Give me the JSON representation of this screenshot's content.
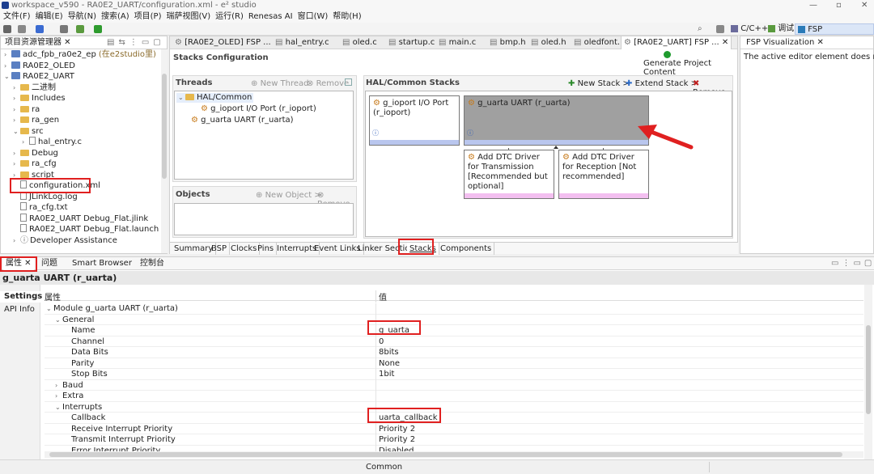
{
  "window": {
    "title": "workspace_v590 - RA0E2_UART/configuration.xml - e² studio"
  },
  "menu": [
    "文件(F)",
    "编辑(E)",
    "导航(N)",
    "搜索(A)",
    "项目(P)",
    "瑞萨视图(V)",
    "运行(R)",
    "Renesas AI",
    "窗口(W)",
    "帮助(H)"
  ],
  "perspectives": [
    "C/C++",
    "调试",
    "FSP Configuration"
  ],
  "explorer": {
    "title": "项目资源管理器",
    "items": [
      {
        "label": "adc_fpb_ra0e2_ep",
        "suffix": "(在e2studio里)",
        "type": "project",
        "arrow": "›",
        "indent": 0
      },
      {
        "label": "RA0E2_OLED",
        "type": "project",
        "arrow": "›",
        "indent": 0
      },
      {
        "label": "RA0E2_UART",
        "type": "project",
        "arrow": "⌄",
        "indent": 0
      },
      {
        "label": "二进制",
        "type": "folder",
        "arrow": "›",
        "indent": 1
      },
      {
        "label": "Includes",
        "type": "folder",
        "arrow": "›",
        "indent": 1
      },
      {
        "label": "ra",
        "type": "folder",
        "arrow": "›",
        "indent": 1
      },
      {
        "label": "ra_gen",
        "type": "folder",
        "arrow": "›",
        "indent": 1
      },
      {
        "label": "src",
        "type": "folder",
        "arrow": "⌄",
        "indent": 1
      },
      {
        "label": "hal_entry.c",
        "type": "file",
        "arrow": "›",
        "indent": 2
      },
      {
        "label": "Debug",
        "type": "folder",
        "arrow": "›",
        "indent": 1
      },
      {
        "label": "ra_cfg",
        "type": "folder",
        "arrow": "›",
        "indent": 1
      },
      {
        "label": "script",
        "type": "folder",
        "arrow": "›",
        "indent": 1
      },
      {
        "label": "configuration.xml",
        "type": "file",
        "arrow": "",
        "indent": 1
      },
      {
        "label": "JLinkLog.log",
        "type": "file",
        "arrow": "",
        "indent": 1
      },
      {
        "label": "ra_cfg.txt",
        "type": "file",
        "arrow": "",
        "indent": 1
      },
      {
        "label": "RA0E2_UART Debug_Flat.jlink",
        "type": "file",
        "arrow": "",
        "indent": 1
      },
      {
        "label": "RA0E2_UART Debug_Flat.launch",
        "type": "file",
        "arrow": "",
        "indent": 1
      },
      {
        "label": "Developer Assistance",
        "type": "help",
        "arrow": "›",
        "indent": 1
      }
    ]
  },
  "editor_tabs": [
    "[RA0E2_OLED] FSP ...",
    "hal_entry.c",
    "oled.c",
    "startup.c",
    "main.c",
    "bmp.h",
    "oled.h",
    "oledfont.h",
    "[RA0E2_UART] FSP ..."
  ],
  "fsp_vis": {
    "tab": "FSP Visualization",
    "message": "The active editor element does not us"
  },
  "stacks": {
    "header": "Stacks Configuration",
    "generate": "Generate Project Content",
    "threads": {
      "title": "Threads",
      "new_thread": "New Thread",
      "remove": "Remove",
      "root": "HAL/Common",
      "items": [
        "g_ioport I/O Port (r_ioport)",
        "g_uarta UART (r_uarta)"
      ]
    },
    "objects": {
      "title": "Objects",
      "new_object": "New Object >",
      "remove": "Remove"
    },
    "hal": {
      "title": "HAL/Common Stacks",
      "new_stack": "New Stack >",
      "extend_stack": "Extend Stack >",
      "remove": "Remove",
      "block1": "g_ioport I/O Port (r_ioport)",
      "block2": "g_uarta UART (r_uarta)",
      "block3": "Add DTC Driver for Transmission [Recommended but optional]",
      "block4": "Add DTC Driver for Reception [Not recommended]"
    },
    "bottom_tabs": [
      "Summary",
      "BSP",
      "Clocks",
      "Pins",
      "Interrupts",
      "Event Links",
      "Linker Section",
      "Stacks",
      "Components"
    ]
  },
  "props": {
    "tabs": [
      "属性",
      "问题",
      "Smart Browser",
      "控制台"
    ],
    "title": "g_uarta UART (r_uarta)",
    "side": [
      "Settings",
      "API Info"
    ],
    "col_prop": "属性",
    "col_val": "值",
    "rows": [
      {
        "k": "Module g_uarta UART (r_uarta)",
        "v": "",
        "lvl": 0,
        "arrow": "⌄"
      },
      {
        "k": "General",
        "v": "",
        "lvl": 1,
        "arrow": "⌄"
      },
      {
        "k": "Name",
        "v": "g_uarta",
        "lvl": 2,
        "arrow": ""
      },
      {
        "k": "Channel",
        "v": "0",
        "lvl": 2,
        "arrow": ""
      },
      {
        "k": "Data Bits",
        "v": "8bits",
        "lvl": 2,
        "arrow": ""
      },
      {
        "k": "Parity",
        "v": "None",
        "lvl": 2,
        "arrow": ""
      },
      {
        "k": "Stop Bits",
        "v": "1bit",
        "lvl": 2,
        "arrow": ""
      },
      {
        "k": "Baud",
        "v": "",
        "lvl": 1,
        "arrow": "›"
      },
      {
        "k": "Extra",
        "v": "",
        "lvl": 1,
        "arrow": "›"
      },
      {
        "k": "Interrupts",
        "v": "",
        "lvl": 1,
        "arrow": "⌄"
      },
      {
        "k": "Callback",
        "v": "uarta_callback",
        "lvl": 2,
        "arrow": ""
      },
      {
        "k": "Receive Interrupt Priority",
        "v": "Priority 2",
        "lvl": 2,
        "arrow": ""
      },
      {
        "k": "Transmit Interrupt Priority",
        "v": "Priority 2",
        "lvl": 2,
        "arrow": ""
      },
      {
        "k": "Error Interrupt Priority",
        "v": "Disabled",
        "lvl": 2,
        "arrow": ""
      }
    ]
  },
  "status": {
    "text": "Common"
  },
  "colors": {
    "accent_red": "#e02020",
    "selected_block": "#a0a0a0",
    "bar_blue": "#b9c6ee",
    "bar_pink": "#f3bff0"
  }
}
